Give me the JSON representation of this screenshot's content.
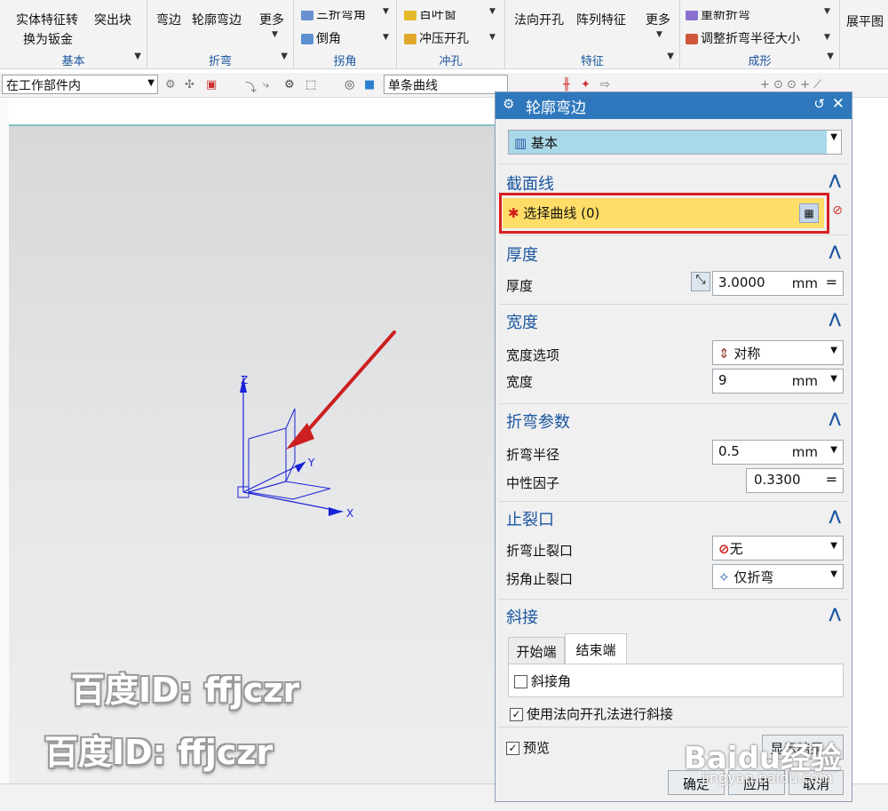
{
  "ribbon": {
    "groups": [
      {
        "caption": "基本",
        "items": [
          "实体特征转",
          "换为钣金",
          "突出块"
        ]
      },
      {
        "caption": "折弯",
        "items": [
          "弯边",
          "轮廓弯边",
          "更多"
        ]
      },
      {
        "caption": "拐角",
        "items": [
          "三折弯角",
          "倒角"
        ]
      },
      {
        "caption": "冲孔",
        "items": [
          "百叶窗",
          "冲压开孔"
        ]
      },
      {
        "caption": "特征",
        "items": [
          "法向开孔",
          "阵列特征",
          "更多"
        ]
      },
      {
        "caption": "成形",
        "items": [
          "重新折弯",
          "调整折弯半径大小"
        ]
      }
    ],
    "truncated": "展平图"
  },
  "selbar": {
    "scope": "在工作部件内",
    "curve_rule": "单条曲线"
  },
  "axes": {
    "x": "X",
    "y": "Y",
    "z": "Z"
  },
  "dialog": {
    "title": "轮廓弯边",
    "type_value": "基本",
    "sections": {
      "section_line": {
        "title": "截面线",
        "select_label": "选择曲线 (0)"
      },
      "thickness": {
        "title": "厚度",
        "label": "厚度",
        "value": "3.0000",
        "unit": "mm",
        "eq": "="
      },
      "width": {
        "title": "宽度",
        "option_label": "宽度选项",
        "option_value": "对称",
        "width_label": "宽度",
        "width_value": "9",
        "width_unit": "mm"
      },
      "bend": {
        "title": "折弯参数",
        "radius_label": "折弯半径",
        "radius_value": "0.5",
        "radius_unit": "mm",
        "neutral_label": "中性因子",
        "neutral_value": "0.3300",
        "eq": "="
      },
      "relief": {
        "title": "止裂口",
        "bend_relief_label": "折弯止裂口",
        "bend_relief_value": "无",
        "corner_relief_label": "拐角止裂口",
        "corner_relief_value": "仅折弯"
      },
      "miter": {
        "title": "斜接",
        "tabs": [
          "开始端",
          "结束端"
        ],
        "miter_corner": "斜接角",
        "miter_corner_checked": false,
        "use_normal": "使用法向开孔法进行斜接",
        "use_normal_checked": true
      }
    },
    "preview": {
      "label": "预览",
      "checked": true,
      "show_result": "显示结果"
    },
    "buttons": {
      "ok": "确定",
      "apply": "应用",
      "cancel": "取消"
    }
  },
  "watermark": {
    "text": "百度ID: ffjczr",
    "brand": "Baidu经验",
    "url": "jingyan.baidu.com"
  },
  "colors": {
    "title_bar": "#2f78bd",
    "highlight": "#ffdd66",
    "callout": "#d62020",
    "arrow": "#cc1f1f",
    "axes": "#1a22d6"
  }
}
